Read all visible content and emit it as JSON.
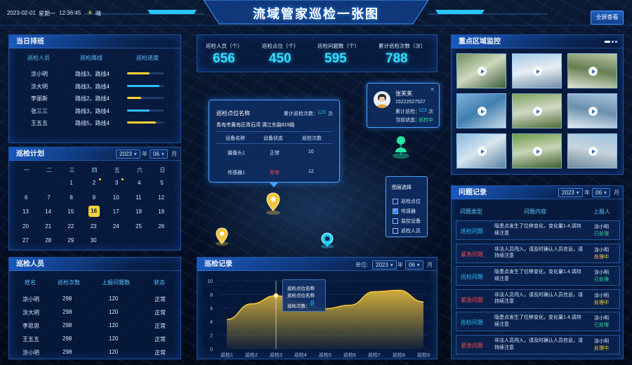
{
  "header": {
    "date": "2023-02-01",
    "weekday": "星期一",
    "time": "12:36:45",
    "weather": "晴",
    "title": "流域管家巡检一张图",
    "fullscreen": "全屏查看"
  },
  "duty": {
    "title": "当日排班",
    "headers": [
      "巡检人员",
      "巡检路线",
      "巡检进度"
    ],
    "rows": [
      {
        "name": "涂小明",
        "route": "路线3，路线4",
        "progress": 0.62,
        "color": "#ffd233"
      },
      {
        "name": "涂大明",
        "route": "路线3，路线4",
        "progress": 0.88,
        "color": "#2fbfff"
      },
      {
        "name": "李丽斯",
        "route": "路线2，路线4",
        "progress": 0.38,
        "color": "#ffd233"
      },
      {
        "name": "张三三",
        "route": "路线3，路线4",
        "progress": 0.62,
        "color": "#2fbfff"
      },
      {
        "name": "王五五",
        "route": "路线5，路线4",
        "progress": 0.78,
        "color": "#ffd233"
      }
    ]
  },
  "plan": {
    "title": "巡检计划",
    "year": "2023",
    "year_unit": "年",
    "month": "06",
    "month_unit": "月",
    "weekdays": [
      "一",
      "二",
      "三",
      "四",
      "五",
      "六",
      "日"
    ],
    "days": [
      "",
      "",
      "1",
      "2",
      "3",
      "4",
      "5",
      "6",
      "7",
      "8",
      "9",
      "10",
      "11",
      "12",
      "13",
      "14",
      "15",
      "16",
      "17",
      "18",
      "19",
      "20",
      "21",
      "22",
      "23",
      "24",
      "25",
      "26",
      "27",
      "28",
      "29",
      "30"
    ],
    "today": "16",
    "dots": [
      "2",
      "3"
    ]
  },
  "stats": [
    {
      "label": "巡检人员（个）",
      "value": "656"
    },
    {
      "label": "巡检点位（个）",
      "value": "450"
    },
    {
      "label": "巡检问题数（个）",
      "value": "595"
    },
    {
      "label": "累计巡检次数（次）",
      "value": "788"
    }
  ],
  "popup": {
    "title": "巡检点位名称",
    "count_label": "累计巡检次数：",
    "count": "123",
    "count_unit": "次",
    "address": "青岛市黄岛区青石湾 漓江东路819路",
    "headers": [
      "设备名称",
      "设备状态",
      "巡检次数"
    ],
    "rows": [
      {
        "name": "摄像头1",
        "status": "正常",
        "count": "10",
        "status_color": "#d9e8ff"
      },
      {
        "name": "传感器1",
        "status": "异常",
        "count": "12",
        "status_color": "#ff4b4b"
      }
    ]
  },
  "person": {
    "name": "张芙芙",
    "phone": "15222527527",
    "total_label": "累计巡检：",
    "total": "123",
    "total_unit": "次",
    "state_label": "当前状态：",
    "state": "巡检中"
  },
  "legend": {
    "title": "图层选择",
    "items": [
      {
        "label": "巡检点位",
        "checked": false
      },
      {
        "label": "传感器",
        "checked": true
      },
      {
        "label": "监控设备",
        "checked": false
      },
      {
        "label": "巡检人员",
        "checked": false
      }
    ]
  },
  "staff": {
    "title": "巡检人员",
    "headers": [
      "姓名",
      "巡检次数",
      "上报问题数",
      "状态"
    ],
    "rows": [
      {
        "name": "涂小明",
        "count": "298",
        "issues": "120",
        "state": "正常"
      },
      {
        "name": "涂大明",
        "count": "298",
        "issues": "120",
        "state": "正常"
      },
      {
        "name": "李思思",
        "count": "298",
        "issues": "120",
        "state": "正常"
      },
      {
        "name": "王五五",
        "count": "298",
        "issues": "120",
        "state": "正常"
      },
      {
        "name": "涂小明",
        "count": "298",
        "issues": "120",
        "state": "正常"
      }
    ]
  },
  "records": {
    "title": "巡检记录",
    "unit_label": "单位:",
    "year": "2023",
    "year_unit": "年",
    "month": "06",
    "month_unit": "月",
    "tooltip": {
      "line1": "巡检点位名称",
      "line2": "巡检点位名称",
      "count_label": "巡检次数：",
      "count": "8"
    }
  },
  "chart_data": {
    "type": "area",
    "categories": [
      "巡检1",
      "巡检2",
      "巡检3",
      "巡检4",
      "巡检5",
      "巡检6",
      "巡检7",
      "巡检8",
      "巡检9"
    ],
    "series": [
      {
        "values": [
          4.3,
          6.6,
          7.8,
          6.8,
          5.9,
          6.4,
          8.4,
          8.6,
          6.9
        ]
      }
    ],
    "ylim": [
      0,
      10
    ],
    "yticks": [
      0,
      2,
      4,
      6,
      8,
      10
    ],
    "highlight_index": 2,
    "grid": true,
    "color": "#f3c53a"
  },
  "monitor": {
    "title": "重点区域监控"
  },
  "issues": {
    "title": "问题记录",
    "year": "2023",
    "year_unit": "年",
    "month": "06",
    "month_unit": "月",
    "headers": [
      "问题类型",
      "问题内容",
      "上报人"
    ],
    "rows": [
      {
        "type": "巡检问题",
        "type_color": "#2fbfff",
        "content": "隐患点发生了位移变化，变化量1.4,请持续注意",
        "person": "涂小明",
        "state": "已处理",
        "state_color": "#2fe09a"
      },
      {
        "type": "紧急问题",
        "type_color": "#ff4b4b",
        "content": "非法人员闯入，请及时确认人员信息，请持续注意",
        "person": "涂小明",
        "state": "处理中",
        "state_color": "#ffd233"
      },
      {
        "type": "巡检问题",
        "type_color": "#2fbfff",
        "content": "隐患点发生了位移变化，变化量1.4,请持续注意",
        "person": "涂小明",
        "state": "已处理",
        "state_color": "#2fe09a"
      },
      {
        "type": "紧急问题",
        "type_color": "#ff4b4b",
        "content": "非法人员闯入，请及时确认人员信息，请持续注意",
        "person": "涂小明",
        "state": "处理中",
        "state_color": "#ffd233"
      },
      {
        "type": "巡检问题",
        "type_color": "#2fbfff",
        "content": "隐患点发生了位移变化，变化量1.4,请持续注意",
        "person": "涂小明",
        "state": "已处理",
        "state_color": "#2fe09a"
      },
      {
        "type": "紧急问题",
        "type_color": "#ff4b4b",
        "content": "非法人员闯入，请及时确认人员信息，请持续注意",
        "person": "涂小明",
        "state": "处理中",
        "state_color": "#ffd233"
      }
    ]
  }
}
